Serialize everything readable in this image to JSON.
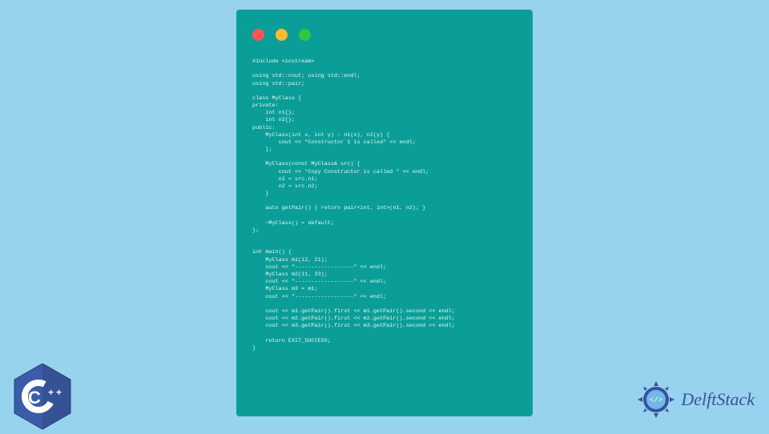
{
  "code_lines": [
    "#include <iostream>",
    "",
    "using std::cout; using std::endl;",
    "using std::pair;",
    "",
    "class MyClass {",
    "private:",
    "    int n1{};",
    "    int n2{};",
    "public:",
    "    MyClass(int x, int y) : n1(x), n2(y) {",
    "        cout << \"Constructor 1 is called\" << endl;",
    "    };",
    "",
    "    MyClass(const MyClass& src) {",
    "        cout << \"Copy Constructor is called \" << endl;",
    "        n1 = src.n1;",
    "        n2 = src.n2;",
    "    }",
    "",
    "    auto getPair() { return pair<int, int>(n1, n2); }",
    "",
    "    ~MyClass() = default;",
    "};",
    "",
    "",
    "int main() {",
    "    MyClass m1(12, 21);",
    "    cout << \"------------------\" << endl;",
    "    MyClass m2(11, 33);",
    "    cout << \"------------------\" << endl;",
    "    MyClass m3 = m1;",
    "    cout << \"------------------\" << endl;",
    "",
    "    cout << m1.getPair().first << m1.getPair().second << endl;",
    "    cout << m2.getPair().first << m2.getPair().second << endl;",
    "    cout << m3.getPair().first << m3.getPair().second << endl;",
    "",
    "    return EXIT_SUCCESS;",
    "}"
  ],
  "logos": {
    "cpp_label": "C++",
    "delft_label": "DelftStack"
  },
  "colors": {
    "background": "#97d3ef",
    "window_bg": "#0b9e98",
    "code_text": "#e9f6f5",
    "dot_red": "#ff5552",
    "dot_yellow": "#ffbb2f",
    "dot_green": "#2bc840",
    "cpp_blue": "#3b5ca8",
    "delft_blue": "#3a519d"
  }
}
